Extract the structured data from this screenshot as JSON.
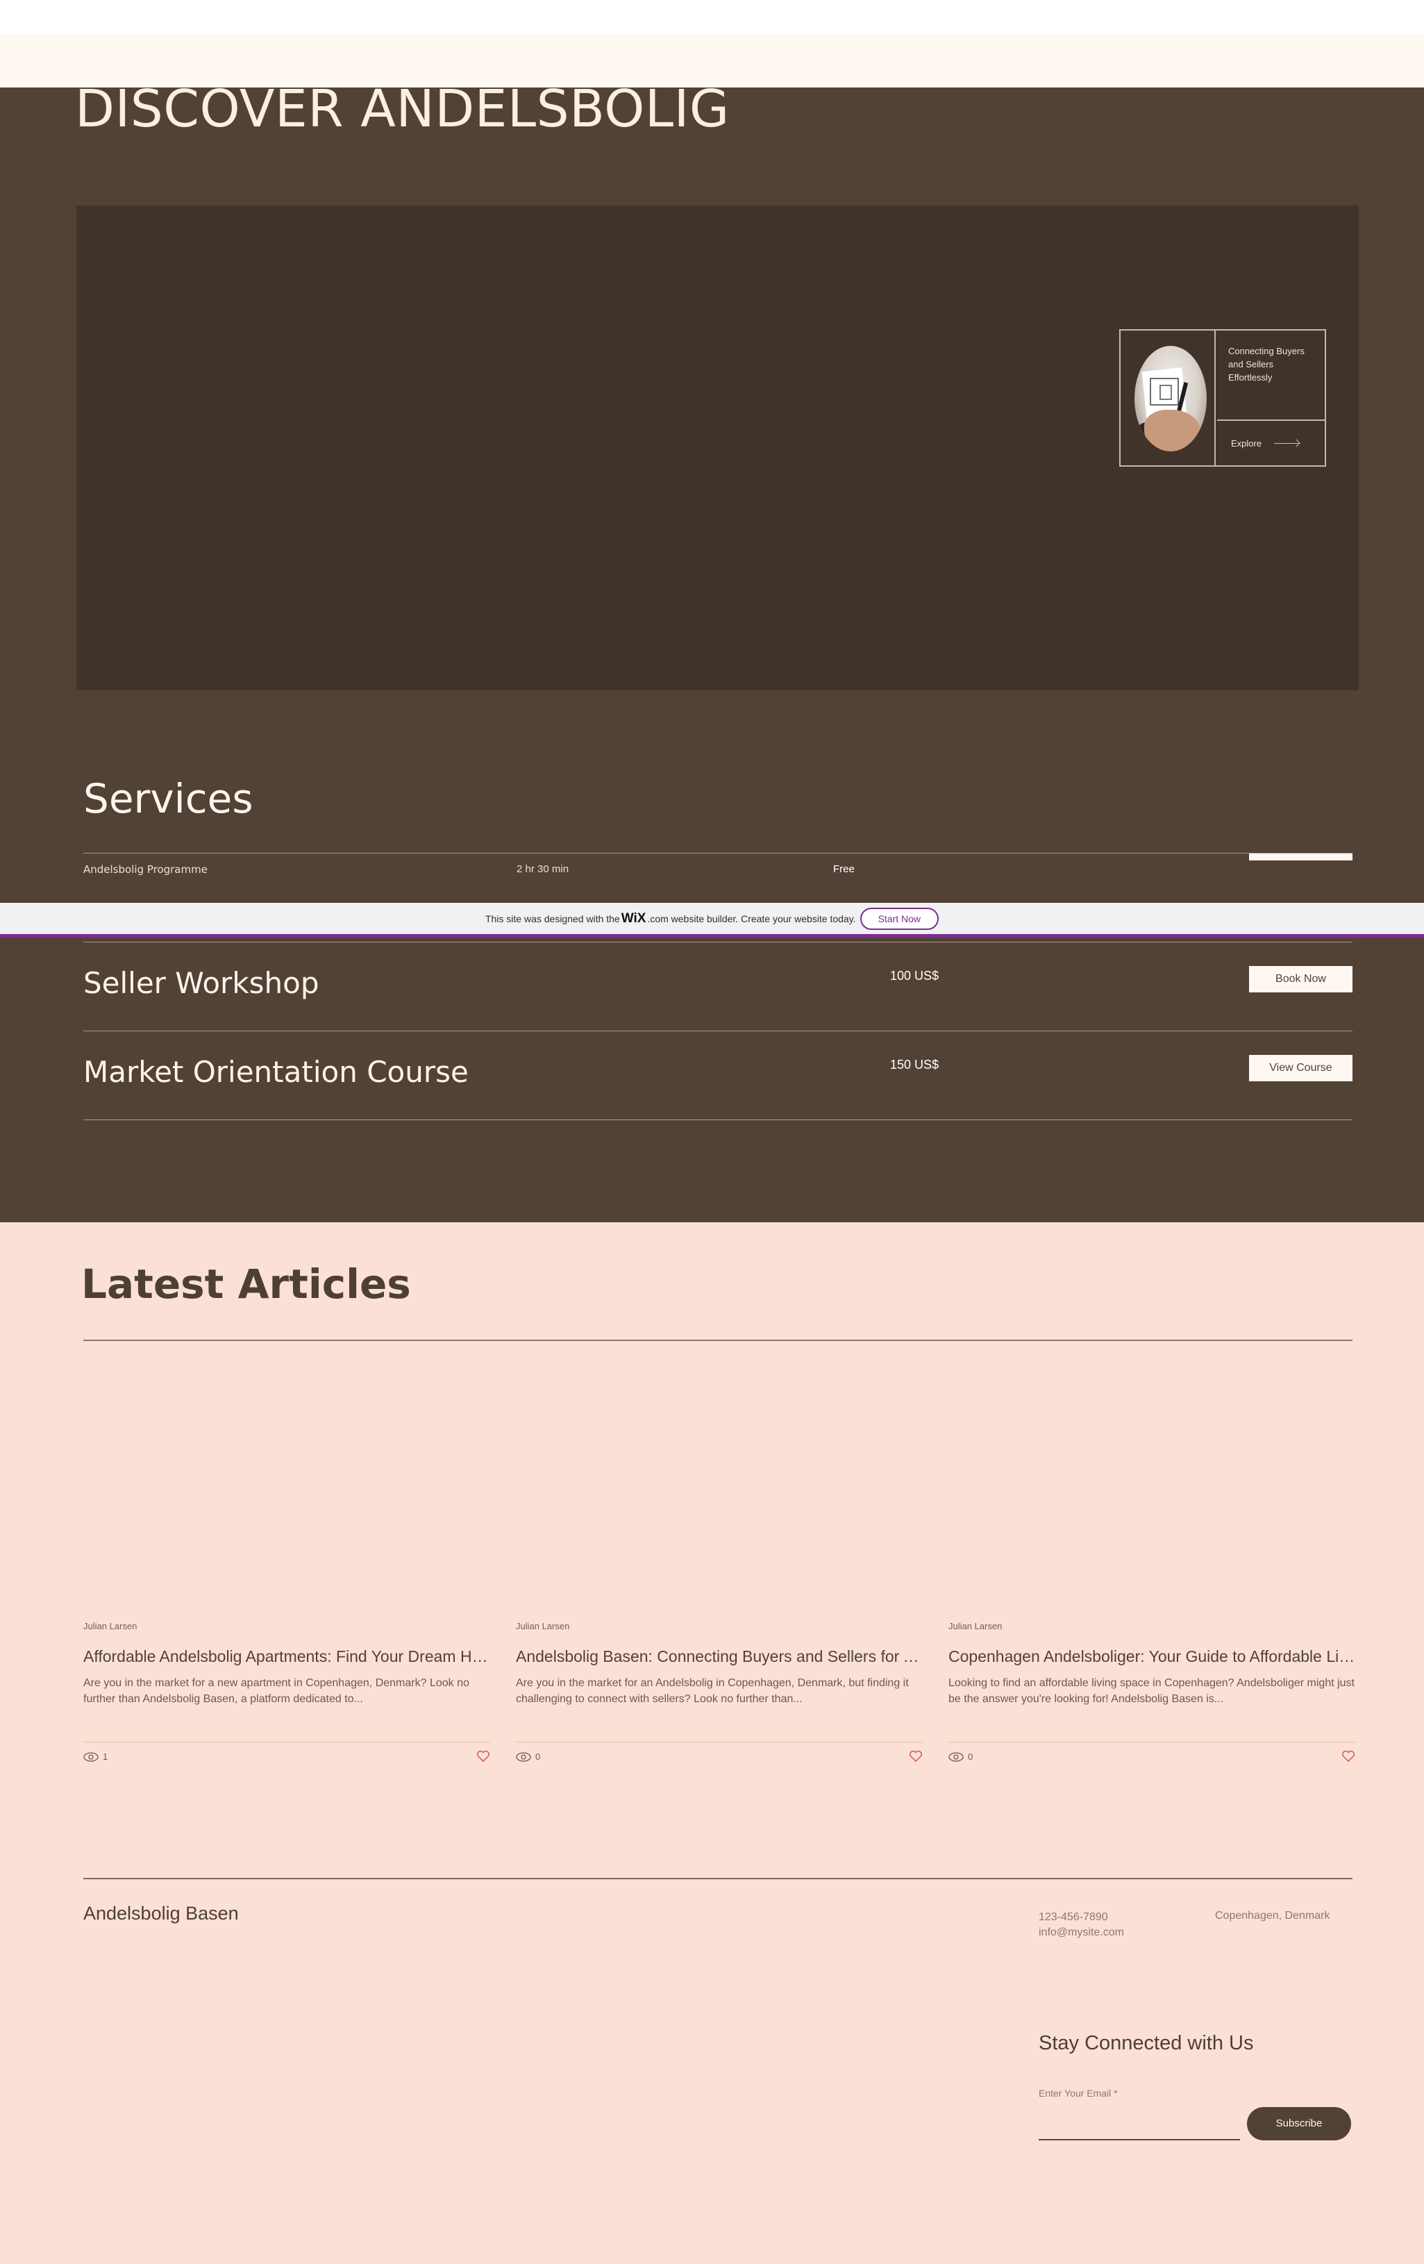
{
  "hero": {
    "title": "DISCOVER ANDELSBOLIG",
    "promo": {
      "text": "Connecting Buyers and Sellers Effortlessly",
      "explore_label": "Explore"
    }
  },
  "services": {
    "title": "Services",
    "items": [
      {
        "name": "Andelsbolig Programme",
        "duration": "2 hr 30 min",
        "price": "Free",
        "button": ""
      },
      {
        "name": "Seller Workshop",
        "duration": "",
        "price": "100 US$",
        "button": "Book Now"
      },
      {
        "name": "Market Orientation Course",
        "duration": "",
        "price": "150 US$",
        "button": "View Course"
      }
    ]
  },
  "wix_banner": {
    "text_before": "This site was designed with the",
    "logo": "WiX",
    "text_after": ".com website builder. Create your website today.",
    "button": "Start Now"
  },
  "articles": {
    "title": "Latest Articles",
    "items": [
      {
        "author": "Julian Larsen",
        "title": "Affordable Andelsbolig Apartments: Find Your Dream Home in Copenhagen",
        "excerpt": "Are you in the market for a new apartment in Copenhagen, Denmark? Look no further than Andelsbolig Basen, a platform dedicated to...",
        "views": "1"
      },
      {
        "author": "Julian Larsen",
        "title": "Andelsbolig Basen: Connecting Buyers and Sellers for Andelsbolig",
        "excerpt": "Are you in the market for an Andelsbolig in Copenhagen, Denmark, but finding it challenging to connect with sellers? Look no further than...",
        "views": "0"
      },
      {
        "author": "Julian Larsen",
        "title": "Copenhagen Andelsboliger: Your Guide to Affordable Living",
        "excerpt": "Looking to find an affordable living space in Copenhagen? Andelsboliger might just be the answer you're looking for! Andelsbolig Basen is...",
        "views": "0"
      }
    ]
  },
  "footer": {
    "brand": "Andelsbolig Basen",
    "phone": "123-456-7890",
    "email": "info@mysite.com",
    "city": "Copenhagen, Denmark",
    "stay_title": "Stay Connected with Us",
    "email_label": "Enter Your Email *",
    "subscribe": "Subscribe"
  },
  "colors": {
    "brown": "#524236",
    "hero_box": "#40342a",
    "peach": "#fbe0d5",
    "cream": "#fff8f1",
    "wix_purple": "#7c2e91"
  }
}
